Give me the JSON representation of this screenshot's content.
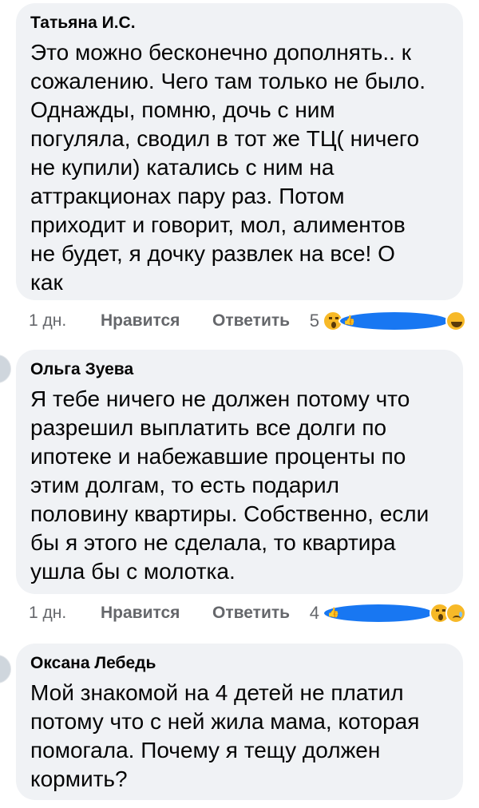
{
  "comments": [
    {
      "author": "Татьяна И.С.",
      "text": "Это можно бесконечно дополнять.. к\nсожалению. Чего там только не было.\nОднажды, помню, дочь с ним\nпогуляла, сводил в тот же ТЦ( ничего\nне купили) катались с ним на\nаттракционах пару раз. Потом\nприходит и говорит, мол, алиментов\nне будет, я дочку развлек на все! О\nкак",
      "time": "1 дн.",
      "like_label": "Нравится",
      "reply_label": "Ответить",
      "reaction_count": "5",
      "reactions": [
        "wow-icon",
        "like-icon",
        "haha-icon"
      ]
    },
    {
      "author": "Ольга Зуева",
      "text": "Я тебе ничего не должен потому что\nразрешил выплатить все долги по\nипотеке и набежавшие проценты по\nэтим долгам, то есть подарил\nполовину квартиры. Собственно, если\nбы я этого не сделала, то квартира\nушла бы с молотка.",
      "time": "1 дн.",
      "like_label": "Нравится",
      "reply_label": "Ответить",
      "reaction_count": "4",
      "reactions": [
        "like-icon",
        "wow-icon",
        "sad-icon"
      ]
    },
    {
      "author": "Оксана Лебедь",
      "text": "Мой знакомой на 4 детей не платил\nпотому что с ней жила мама, которая\nпомогала. Почему я тещу должен\nкормить?"
    }
  ]
}
